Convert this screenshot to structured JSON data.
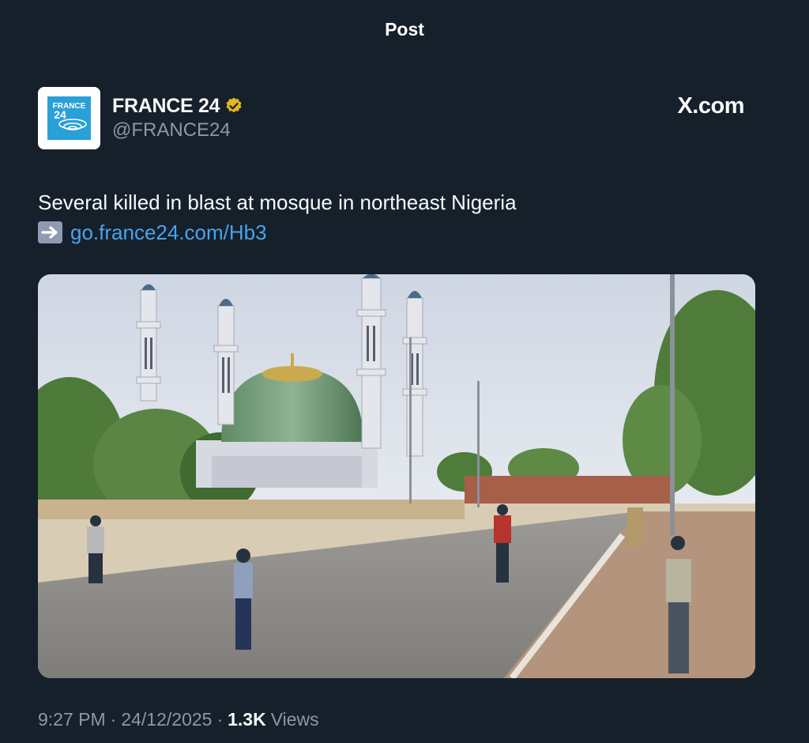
{
  "header": {
    "title": "Post"
  },
  "author": {
    "name": "FRANCE 24",
    "handle": "@FRANCE24",
    "logo_text_top": "FRANCE",
    "logo_text_bottom": "24",
    "verified": true,
    "avatar_icon": "france24-logo-icon"
  },
  "site_label": "X.com",
  "post": {
    "text": "Several killed in blast at mosque in northeast Nigeria",
    "link_icon": "right-arrow-emoji-icon",
    "link_text": "go.france24.com/Hb3",
    "image_alt": "Street scene with a large green-domed mosque and four minarets, people walking along a sandy road"
  },
  "meta": {
    "time": "9:27 PM",
    "date": "24/12/2025",
    "views_count": "1.3K",
    "views_label": "Views"
  },
  "colors": {
    "background": "#15202b",
    "link": "#4aa3ea",
    "secondary_text": "#8b98a5",
    "verified_gold": "#e2b719",
    "brand_blue": "#2aa0d8"
  }
}
